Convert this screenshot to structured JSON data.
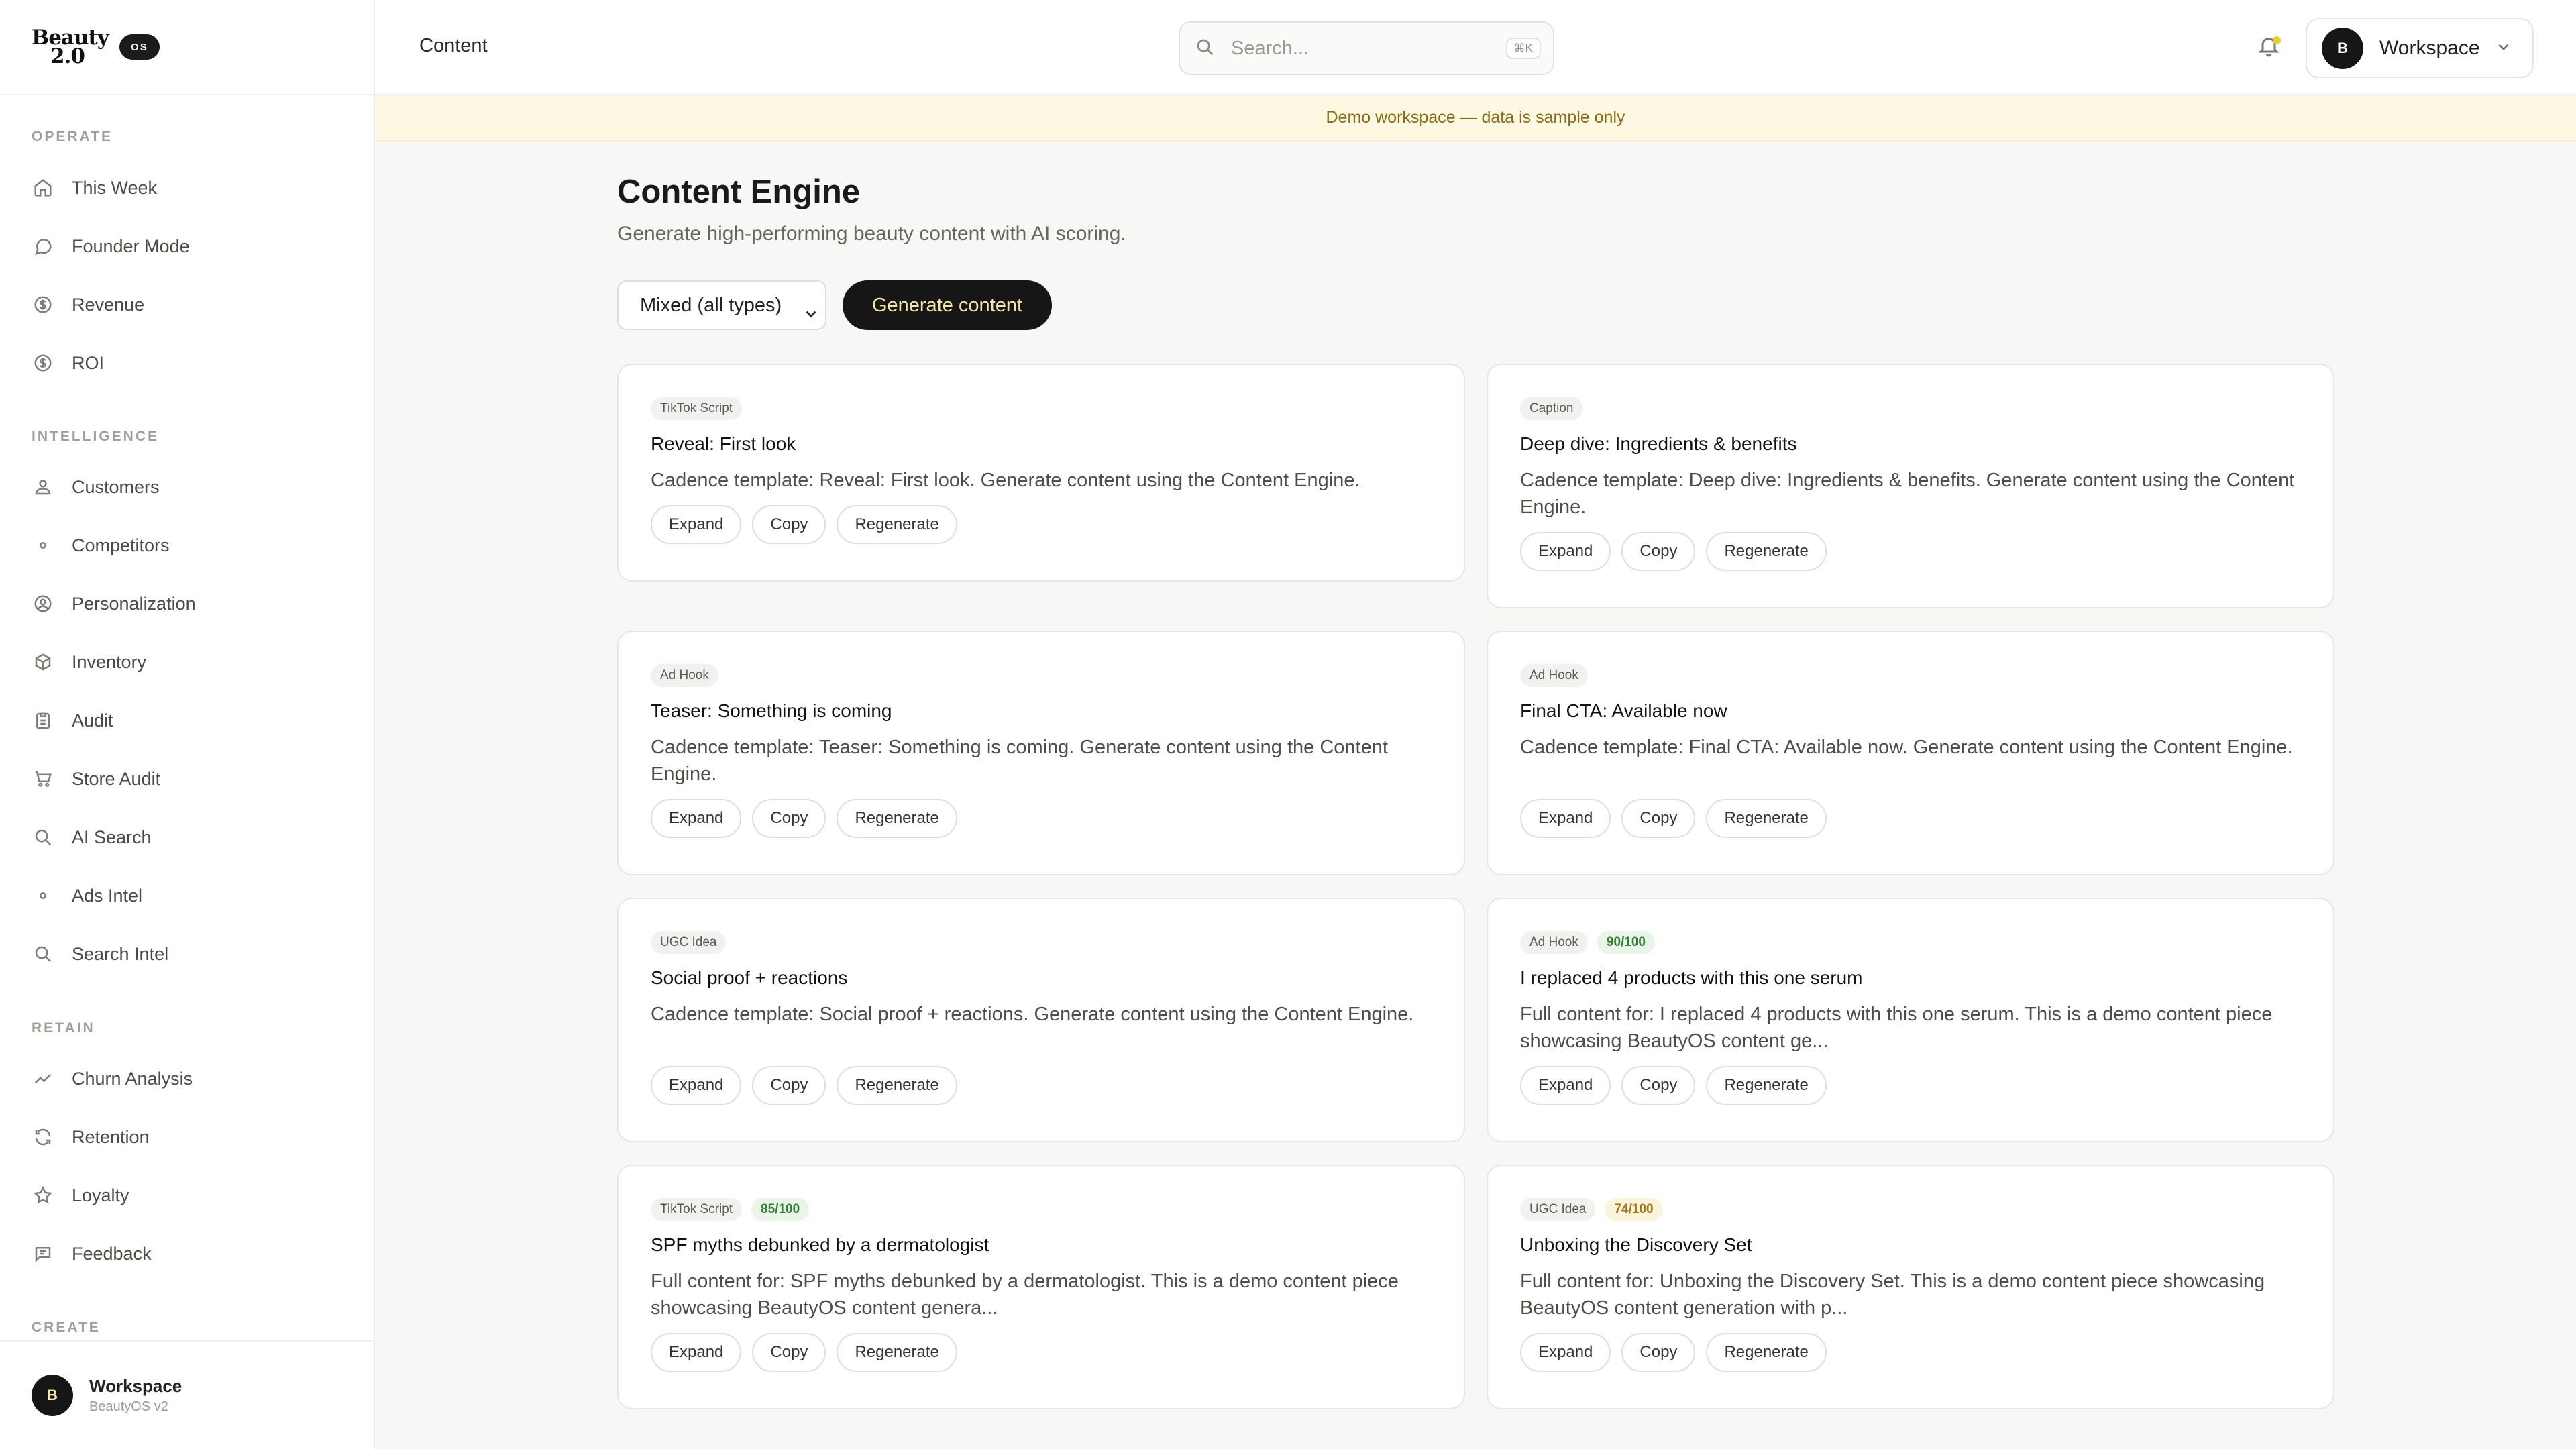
{
  "brand": {
    "line1": "Beauty",
    "line2": "2.0",
    "badge": "OS"
  },
  "sidebar": {
    "sections": [
      {
        "label": "OPERATE",
        "items": [
          {
            "label": "This Week",
            "icon": "home-icon"
          },
          {
            "label": "Founder Mode",
            "icon": "chat-bubble-icon"
          },
          {
            "label": "Revenue",
            "icon": "dollar-circle-icon"
          },
          {
            "label": "ROI",
            "icon": "dollar-circle-icon"
          }
        ]
      },
      {
        "label": "INTELLIGENCE",
        "items": [
          {
            "label": "Customers",
            "icon": "users-icon"
          },
          {
            "label": "Competitors",
            "icon": "dot-icon"
          },
          {
            "label": "Personalization",
            "icon": "user-circle-icon"
          },
          {
            "label": "Inventory",
            "icon": "box-icon"
          },
          {
            "label": "Audit",
            "icon": "clipboard-icon"
          },
          {
            "label": "Store Audit",
            "icon": "cart-icon"
          },
          {
            "label": "AI Search",
            "icon": "search-icon"
          },
          {
            "label": "Ads Intel",
            "icon": "dot-icon"
          },
          {
            "label": "Search Intel",
            "icon": "search-icon"
          }
        ]
      },
      {
        "label": "RETAIN",
        "items": [
          {
            "label": "Churn Analysis",
            "icon": "trend-line-icon"
          },
          {
            "label": "Retention",
            "icon": "refresh-icon"
          },
          {
            "label": "Loyalty",
            "icon": "star-icon"
          },
          {
            "label": "Feedback",
            "icon": "message-square-icon"
          }
        ]
      },
      {
        "label": "CREATE",
        "items": []
      }
    ],
    "footer": {
      "avatar": "B",
      "name": "Workspace",
      "sub": "BeautyOS v2"
    }
  },
  "header": {
    "breadcrumb": "Content",
    "search_placeholder": "Search...",
    "shortcut": "⌘K",
    "workspace_avatar": "B",
    "workspace_label": "Workspace"
  },
  "banner": "Demo workspace — data is sample only",
  "main": {
    "title": "Content Engine",
    "subtitle": "Generate high-performing beauty content with AI scoring.",
    "type_select": "Mixed (all types)",
    "generate_label": "Generate content"
  },
  "card_actions": {
    "expand": "Expand",
    "copy": "Copy",
    "regenerate": "Regenerate"
  },
  "cards": [
    {
      "tag": "TikTok Script",
      "score": "",
      "title": "Reveal: First look",
      "desc": "Cadence template: Reveal: First look. Generate content using the Content Engine."
    },
    {
      "tag": "Caption",
      "score": "",
      "title": "Deep dive: Ingredients & benefits",
      "desc": "Cadence template: Deep dive: Ingredients & benefits. Generate content using the Content Engine."
    },
    {
      "tag": "Ad Hook",
      "score": "",
      "title": "Teaser: Something is coming",
      "desc": "Cadence template: Teaser: Something is coming. Generate content using the Content Engine."
    },
    {
      "tag": "Ad Hook",
      "score": "",
      "title": "Final CTA: Available now",
      "desc": "Cadence template: Final CTA: Available now. Generate content using the Content Engine."
    },
    {
      "tag": "UGC Idea",
      "score": "",
      "title": "Social proof + reactions",
      "desc": "Cadence template: Social proof + reactions. Generate content using the Content Engine."
    },
    {
      "tag": "Ad Hook",
      "score": "90/100",
      "title": "I replaced 4 products with this one serum",
      "desc": "Full content for: I replaced 4 products with this one serum. This is a demo content piece showcasing BeautyOS content ge..."
    },
    {
      "tag": "TikTok Script",
      "score": "85/100",
      "title": "SPF myths debunked by a dermatologist",
      "desc": "Full content for: SPF myths debunked by a dermatologist. This is a demo content piece showcasing BeautyOS content genera..."
    },
    {
      "tag": "UGC Idea",
      "score": "74/100",
      "title": "Unboxing the Discovery Set",
      "desc": "Full content for: Unboxing the Discovery Set. This is a demo content piece showcasing BeautyOS content generation with p..."
    }
  ],
  "colors": {
    "accent": "#161616",
    "accent_text": "#f5e6a3",
    "banner_bg": "#fdf8e2",
    "score_green": "#2e7d32",
    "score_amber": "#a5740e"
  }
}
